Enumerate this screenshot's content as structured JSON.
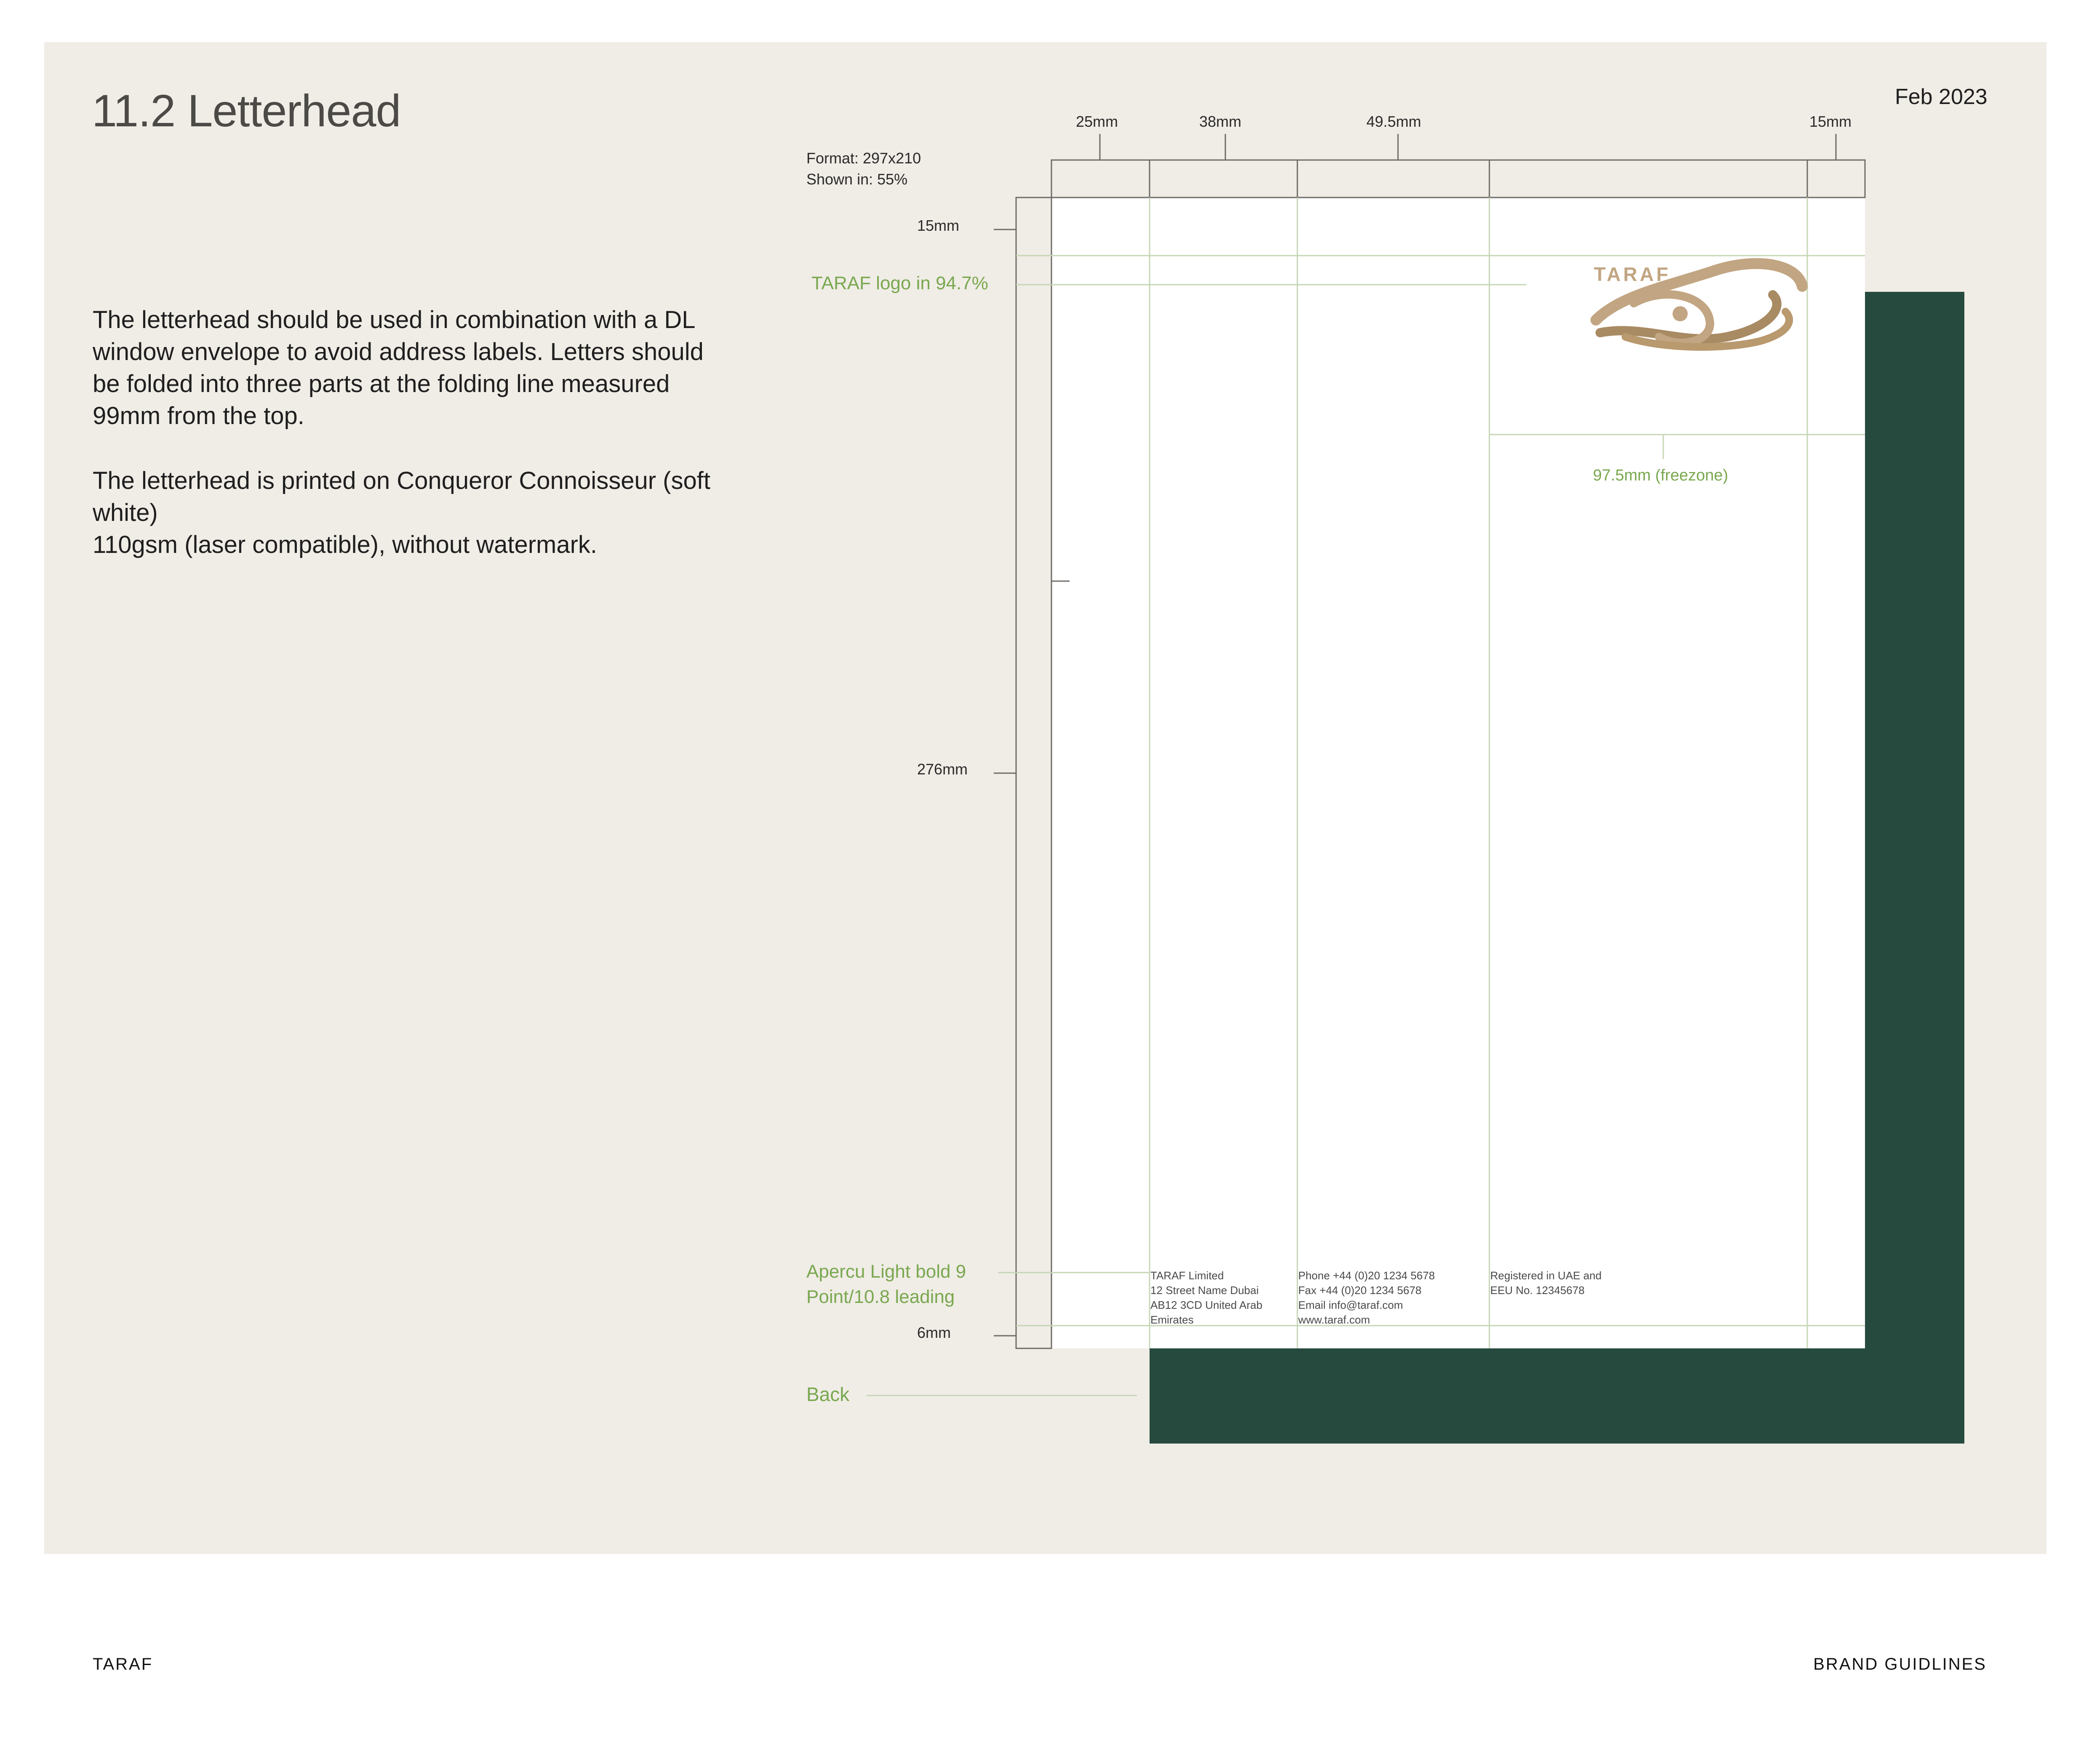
{
  "header": {
    "title": "11.2 Letterhead",
    "date": "Feb 2023"
  },
  "description": {
    "paragraph1": "The letterhead should be used in combination with a DL window envelope to avoid address labels. Letters should be folded into three parts at the folding line measured 99mm from the top.",
    "paragraph2_line1": "The letterhead is printed on Conqueror Connoisseur (soft white)",
    "paragraph2_line2": "110gsm (laser compatible), without watermark."
  },
  "spec": {
    "format": "Format: 297x210",
    "shown": "Shown in: 55%",
    "columns": [
      "25mm",
      "38mm",
      "49.5mm",
      "15mm"
    ],
    "top_margin": "15mm",
    "logo_note": "TARAF logo in 94.7%",
    "height": "276mm",
    "font_note_line1": "Apercu Light bold 9",
    "font_note_line2": "Point/10.8 leading",
    "bottom_margin": "6mm",
    "back_label": "Back",
    "freezone": "97.5mm (freezone)"
  },
  "letterhead": {
    "logo_text": "TARAF",
    "footer_col1": [
      "TARAF Limited",
      "12 Street Name Dubai",
      "AB12 3CD United Arab",
      "Emirates"
    ],
    "footer_col2": [
      "Phone +44 (0)20 1234 5678",
      "Fax +44 (0)20 1234 5678",
      "Email info@taraf.com",
      "www.taraf.com"
    ],
    "footer_col3": [
      "Registered in UAE and",
      "EEU No. 12345678"
    ]
  },
  "footer": {
    "brand": "TARAF",
    "section": "BRAND GUIDLINES"
  },
  "colors": {
    "panel": "#f0ece6",
    "back_sheet": "#264b3e",
    "accent_green": "#79a84f",
    "logo_gold": "#c2a582"
  }
}
